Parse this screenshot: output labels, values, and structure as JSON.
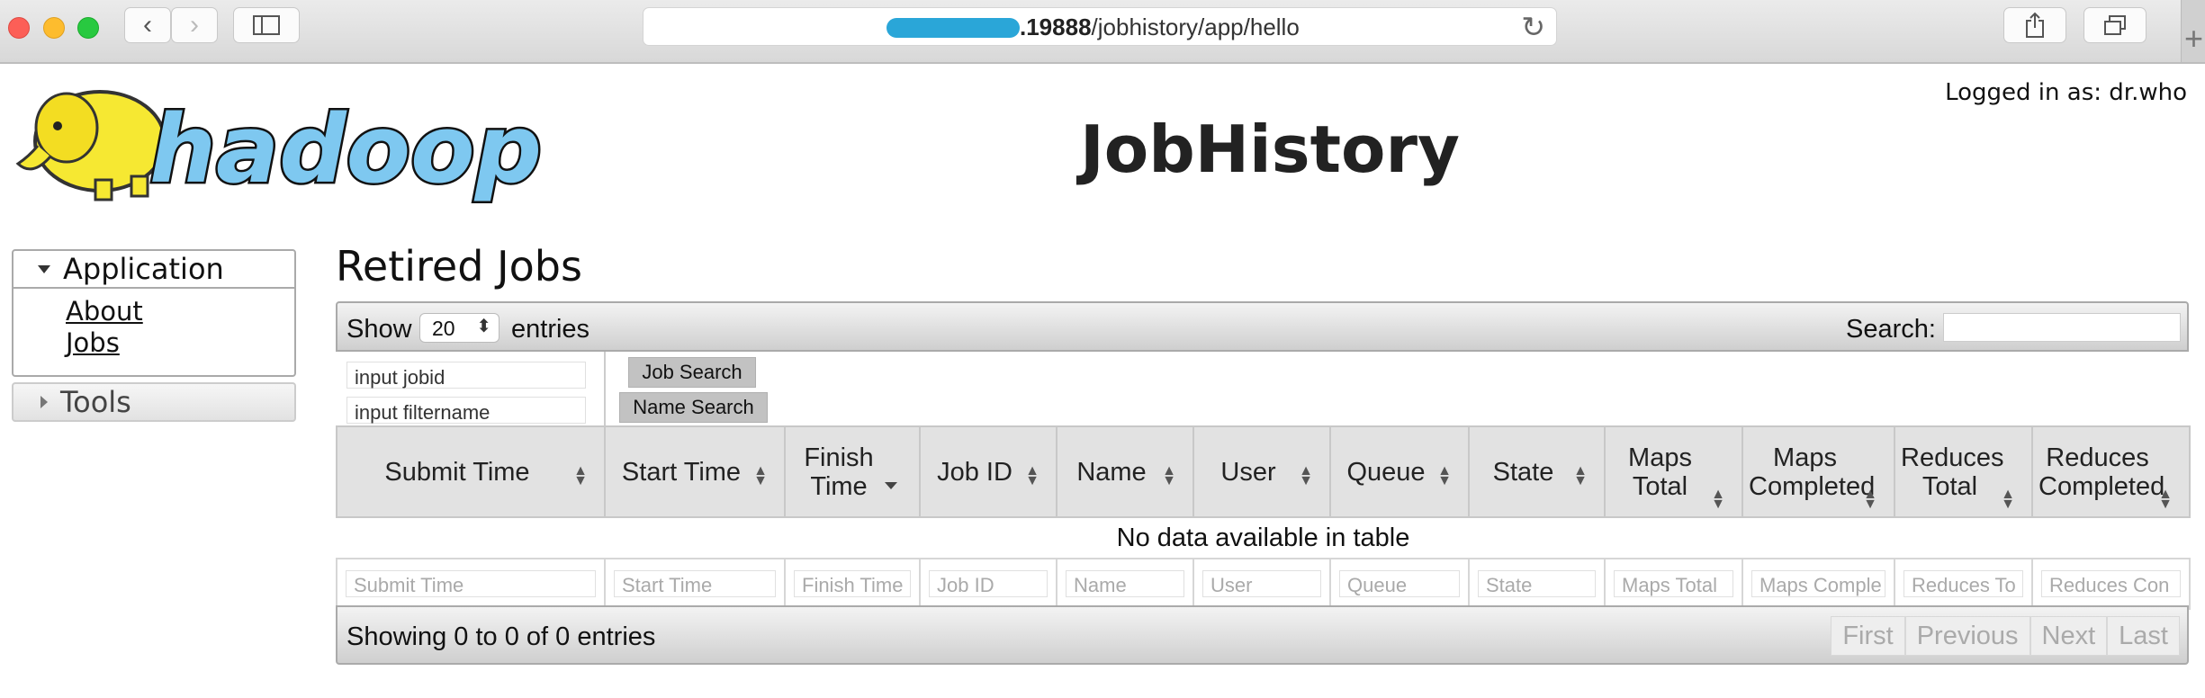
{
  "browser": {
    "url_host_suffix": ".19888",
    "url_path": "/jobhistory/app/hello",
    "icons": [
      "back-icon",
      "forward-icon",
      "sidebar-icon",
      "reload-icon",
      "share-icon",
      "tabs-icon",
      "new-tab-icon"
    ]
  },
  "header": {
    "logo_text": "hadoop",
    "title": "JobHistory",
    "login": "Logged in as: dr.who"
  },
  "sidebar": {
    "application_label": "Application",
    "links": [
      "About",
      "Jobs"
    ],
    "tools_label": "Tools"
  },
  "main": {
    "section_title": "Retired Jobs",
    "show_label": "Show",
    "entries_value": "20",
    "entries_label": "entries",
    "search_label": "Search:",
    "search_value": "",
    "jobid_input": "input jobid",
    "filtername_input": "input filtername",
    "job_search_button": "Job Search",
    "name_search_button": "Name Search",
    "columns": [
      "Submit Time",
      "Start Time",
      "Finish Time",
      "Job ID",
      "Name",
      "User",
      "Queue",
      "State",
      "Maps Total",
      "Maps Completed",
      "Reduces Total",
      "Reduces Completed"
    ],
    "empty_message": "No data available in table",
    "column_filter_placeholders": [
      "Submit Time",
      "Start Time",
      "Finish Time",
      "Job ID",
      "Name",
      "User",
      "Queue",
      "State",
      "Maps Total",
      "Maps Comple",
      "Reduces To",
      "Reduces Con"
    ],
    "info": "Showing 0 to 0 of 0 entries",
    "pager": [
      "First",
      "Previous",
      "Next",
      "Last"
    ]
  },
  "colors": {
    "logo_elephant": "#f6e832",
    "logo_text": "#7ec8f0",
    "address_blur": "#2aa6d8"
  }
}
